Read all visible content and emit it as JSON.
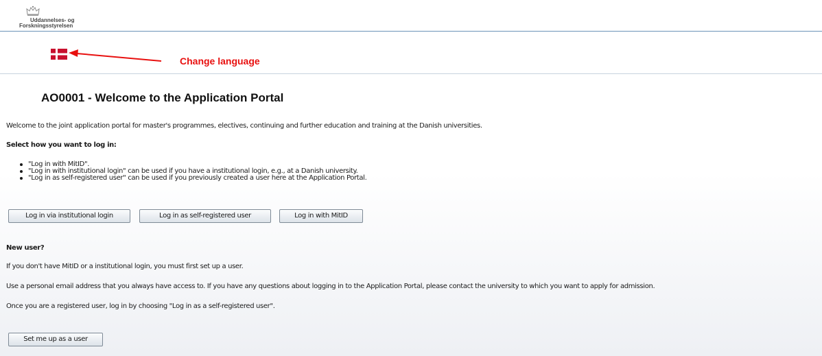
{
  "header": {
    "logo_line1": "Uddannelses- og",
    "logo_line2": "Forskningsstyrelsen",
    "crown_icon": "crown-icon"
  },
  "language": {
    "flag_icon": "danish-flag-icon",
    "annotation": "Change language",
    "annotation_color": "#e8100f"
  },
  "main": {
    "title": "AO0001 - Welcome to the Application Portal",
    "intro": "Welcome to the joint application portal for master's programmes, electives, continuing and further education and training at the Danish universities.",
    "login_heading": "Select how you want to log in:",
    "bullets": [
      "\"Log in with MitID\".",
      "\"Log in with institutional login\" can be used if you have a institutional login, e.g., at a Danish university.",
      "\"Log in as self-registered user\" can be used if you previously created a user here at the Application Portal."
    ],
    "buttons": {
      "institutional": "Log in via institutional login",
      "self_registered": "Log in as self-registered user",
      "mitid": "Log in with MitID"
    },
    "new_user_heading": "New user?",
    "new_user_p1": "If you don't have MitID or a institutional login, you must first set up a user.",
    "new_user_p2": "Use a personal email address that you always have access to. If you have any questions about logging in to the Application Portal, please contact the university to which you want to apply for admission.",
    "new_user_p3": "Once you are a registered user, log in by choosing \"Log in as a self-registered user\".",
    "setup_button": "Set me up as a user"
  },
  "colors": {
    "header_line": "#6a93b8",
    "button_border": "#7e8a96"
  }
}
